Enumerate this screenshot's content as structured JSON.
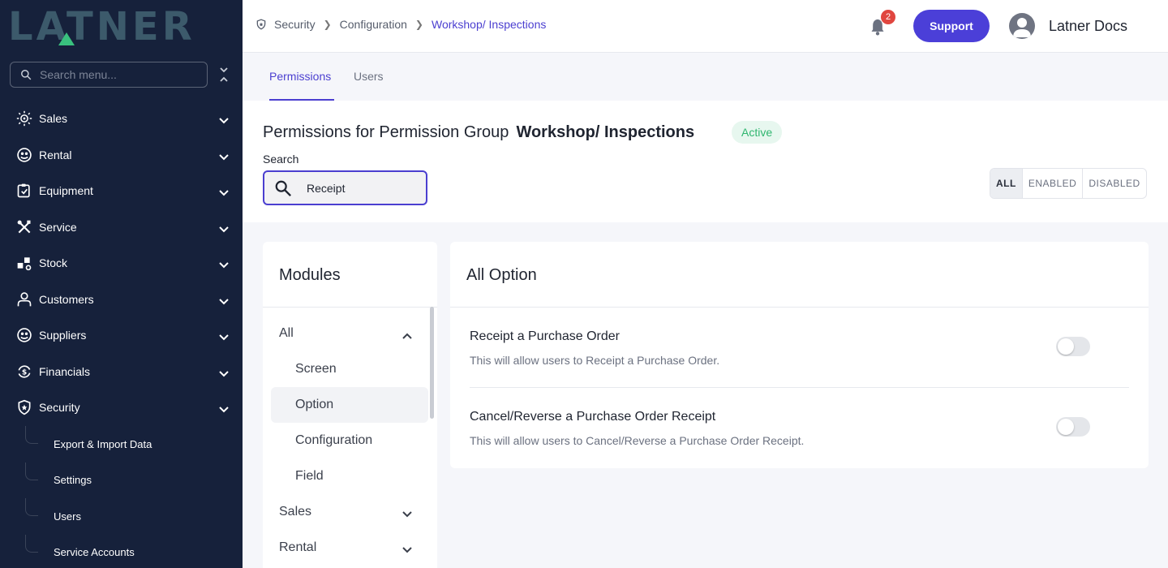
{
  "sidebar": {
    "logo": "LATNER",
    "search_placeholder": "Search menu...",
    "items": [
      {
        "label": "Sales",
        "icon": "sales-icon"
      },
      {
        "label": "Rental",
        "icon": "rental-icon"
      },
      {
        "label": "Equipment",
        "icon": "equipment-icon"
      },
      {
        "label": "Service",
        "icon": "service-icon"
      },
      {
        "label": "Stock",
        "icon": "stock-icon"
      },
      {
        "label": "Customers",
        "icon": "user-icon"
      },
      {
        "label": "Suppliers",
        "icon": "suppliers-icon"
      },
      {
        "label": "Financials",
        "icon": "financials-icon"
      },
      {
        "label": "Security",
        "icon": "shield-icon"
      }
    ],
    "security_sub": [
      {
        "label": "Export & Import Data"
      },
      {
        "label": "Settings"
      },
      {
        "label": "Users"
      },
      {
        "label": "Service Accounts"
      }
    ]
  },
  "header": {
    "breadcrumb": [
      "Security",
      "Configuration",
      "Workshop/ Inspections"
    ],
    "notification_count": "2",
    "support_label": "Support",
    "user_name": "Latner Docs"
  },
  "tabs": [
    {
      "label": "Permissions",
      "active": true
    },
    {
      "label": "Users",
      "active": false
    }
  ],
  "page": {
    "title_prefix": "Permissions for Permission Group",
    "group_name": "Workshop/ Inspections",
    "status": "Active",
    "search_label": "Search",
    "search_value": "Receipt",
    "filters": [
      "ALL",
      "ENABLED",
      "DISABLED"
    ]
  },
  "modules": {
    "title": "Modules",
    "items": [
      {
        "label": "All",
        "expanded": true
      },
      {
        "label": "Screen"
      },
      {
        "label": "Option",
        "selected": true
      },
      {
        "label": "Configuration"
      },
      {
        "label": "Field"
      },
      {
        "label": "Sales"
      },
      {
        "label": "Rental"
      }
    ]
  },
  "options": {
    "title": "All Option",
    "items": [
      {
        "title": "Receipt a Purchase Order",
        "description": "This will allow users to Receipt a Purchase Order.",
        "enabled": false
      },
      {
        "title": "Cancel/Reverse a Purchase Order Receipt",
        "description": "This will allow users to Cancel/Reverse a Purchase Order Receipt.",
        "enabled": false
      }
    ]
  },
  "colors": {
    "sidebar_bg": "#16213b",
    "accent": "#4b3fd0",
    "status_green": "#2fb66f",
    "badge_red": "#e0463f"
  }
}
